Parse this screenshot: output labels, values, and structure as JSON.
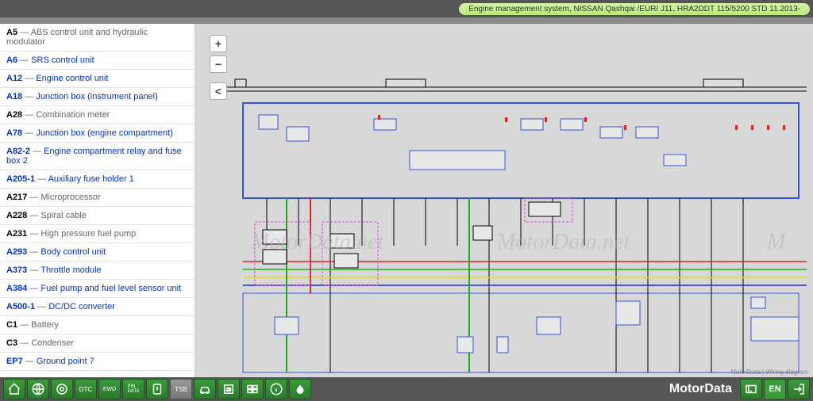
{
  "header": {
    "title": "Engine management system, NISSAN Qashqai /EUR/ J11, HRA2DDT 115/5200 STD 11.2013-"
  },
  "sidebar": {
    "items": [
      {
        "code": "A5",
        "desc": "ABS control unit and hydraulic modulator",
        "link": false
      },
      {
        "code": "A6",
        "desc": "SRS control unit",
        "link": true
      },
      {
        "code": "A12",
        "desc": "Engine control unit",
        "link": true
      },
      {
        "code": "A18",
        "desc": "Junction box (instrument panel)",
        "link": true
      },
      {
        "code": "A28",
        "desc": "Combination meter",
        "link": false
      },
      {
        "code": "A78",
        "desc": "Junction box (engine compartment)",
        "link": true
      },
      {
        "code": "A82-2",
        "desc": "Engine compartment relay and fuse box 2",
        "link": true
      },
      {
        "code": "A205-1",
        "desc": "Auxiliary fuse holder 1",
        "link": true
      },
      {
        "code": "A217",
        "desc": "Microprocessor",
        "link": false
      },
      {
        "code": "A228",
        "desc": "Spiral cable",
        "link": false
      },
      {
        "code": "A231",
        "desc": "High pressure fuel pump",
        "link": false
      },
      {
        "code": "A293",
        "desc": "Body control unit",
        "link": true
      },
      {
        "code": "A373",
        "desc": "Throttle module",
        "link": true
      },
      {
        "code": "A384",
        "desc": "Fuel pump and fuel level sensor unit",
        "link": true
      },
      {
        "code": "A500-1",
        "desc": "DC/DC converter",
        "link": true
      },
      {
        "code": "C1",
        "desc": "Battery",
        "link": false
      },
      {
        "code": "C3",
        "desc": "Condenser",
        "link": false
      },
      {
        "code": "EP7",
        "desc": "Ground point 7",
        "link": true
      }
    ]
  },
  "zoom": {
    "in": "+",
    "out": "−",
    "back": "<"
  },
  "watermarks": [
    "MotorData.net",
    "MotorData.net",
    "M"
  ],
  "credit": "MotorData | Wiring diagram",
  "brand": "MotorData",
  "lang": "EN",
  "toolbar": {
    "icons": [
      "home",
      "globe",
      "target",
      "dtc",
      "ewd",
      "pindata",
      "gauge",
      "tsb",
      "car",
      "jb",
      "grid",
      "circle",
      "oil"
    ]
  }
}
